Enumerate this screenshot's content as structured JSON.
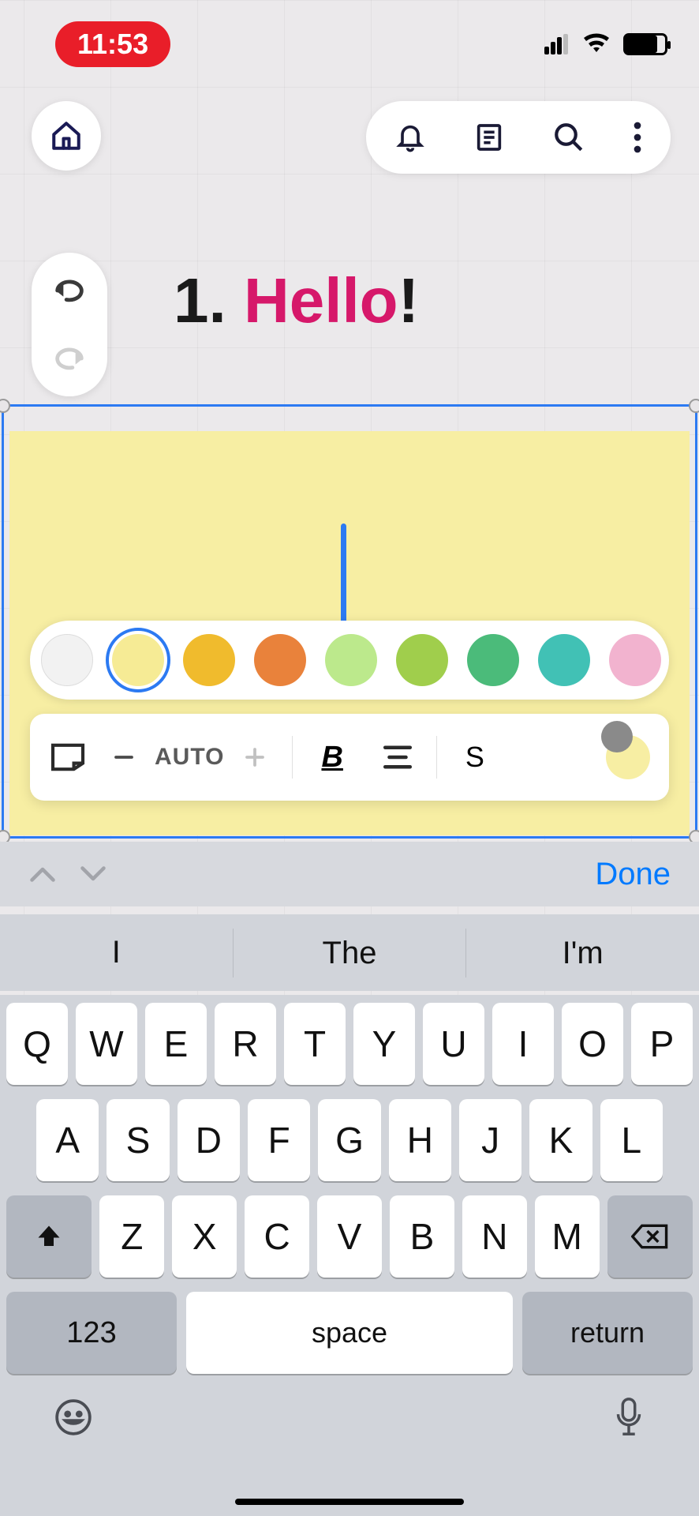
{
  "status": {
    "time": "11:53"
  },
  "heading": {
    "number": "1. ",
    "word": "Hello",
    "bang": "!"
  },
  "colors": [
    "#f2f2f2",
    "#f6eb95",
    "#f0bb2d",
    "#e9823b",
    "#bce98c",
    "#a0ce4c",
    "#4bbb7a",
    "#41c1b5",
    "#f2b3cf"
  ],
  "selectedColorIndex": 1,
  "format": {
    "auto": "AUTO",
    "bold": "B",
    "size": "S"
  },
  "accessory": {
    "done": "Done"
  },
  "suggestions": [
    "I",
    "The",
    "I'm"
  ],
  "keyboard": {
    "row1": [
      "Q",
      "W",
      "E",
      "R",
      "T",
      "Y",
      "U",
      "I",
      "O",
      "P"
    ],
    "row2": [
      "A",
      "S",
      "D",
      "F",
      "G",
      "H",
      "J",
      "K",
      "L"
    ],
    "row3": [
      "Z",
      "X",
      "C",
      "V",
      "B",
      "N",
      "M"
    ],
    "numKey": "123",
    "space": "space",
    "return": "return"
  }
}
